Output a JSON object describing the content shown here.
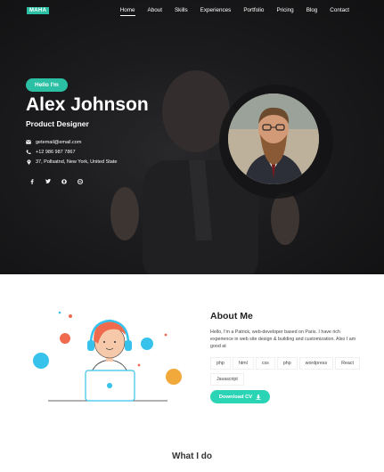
{
  "brand": {
    "logo": "MAHA"
  },
  "nav": {
    "items": [
      {
        "label": "Home",
        "active": true
      },
      {
        "label": "About"
      },
      {
        "label": "Skills"
      },
      {
        "label": "Experiences"
      },
      {
        "label": "Portfolio"
      },
      {
        "label": "Pricing"
      },
      {
        "label": "Blog"
      },
      {
        "label": "Contact"
      }
    ]
  },
  "hero": {
    "greeting": "Hello I'm",
    "name": "Alex Johnson",
    "role": "Product Designer",
    "contacts": [
      {
        "icon": "envelope-icon",
        "text": "getemail@email.com"
      },
      {
        "icon": "phone-icon",
        "text": "+12 986 987 7867"
      },
      {
        "icon": "map-pin-icon",
        "text": "37, Pollsatnd, New York, United State"
      }
    ],
    "socials": [
      "facebook-icon",
      "twitter-icon",
      "github-icon",
      "dribbble-icon"
    ]
  },
  "about": {
    "title": "About Me",
    "text": "Hello, I'm a Patrick, web-developer based on Paris. I have rich experience in web site design & building and customization. Also I am good at",
    "tags": [
      "php",
      "html",
      "css",
      "php",
      "wordpress",
      "React",
      "Javascript"
    ],
    "download_label": "Download CV"
  },
  "services": {
    "title": "What I do"
  },
  "colors": {
    "accent": "#2bbfa4",
    "button": "#2bd4b4"
  }
}
